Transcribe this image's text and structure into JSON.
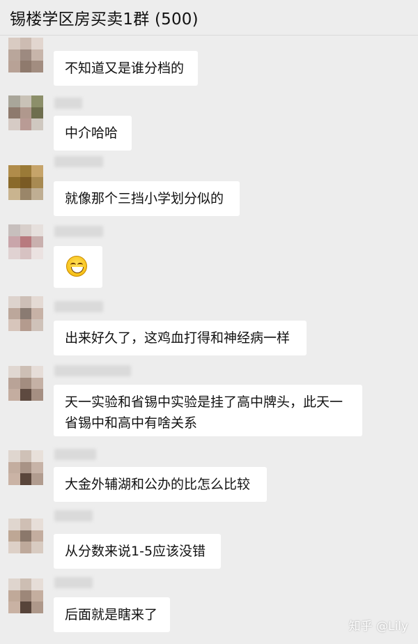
{
  "chat": {
    "title": "锡楼学区房买卖1群 (500)"
  },
  "messages": [
    {
      "text": "不知道又是谁分档的"
    },
    {
      "text": "中介哈哈"
    },
    {
      "text": "就像那个三挡小学划分似的"
    },
    {
      "text": "",
      "emoji": "grinning-face-emoji"
    },
    {
      "text": "出来好久了，这鸡血打得和神经病一样"
    },
    {
      "text": "天一实验和省锡中实验是挂了高中牌头，此天一省锡中和高中有啥关系"
    },
    {
      "text": "大金外辅湖和公办的比怎么比较"
    },
    {
      "text": "从分数来说1-5应该没错"
    },
    {
      "text": "后面就是瞎来了"
    }
  ],
  "watermark": "知乎 @Lily",
  "colors": {
    "background": "#ededed",
    "bubble": "#ffffff",
    "text": "#111111"
  }
}
